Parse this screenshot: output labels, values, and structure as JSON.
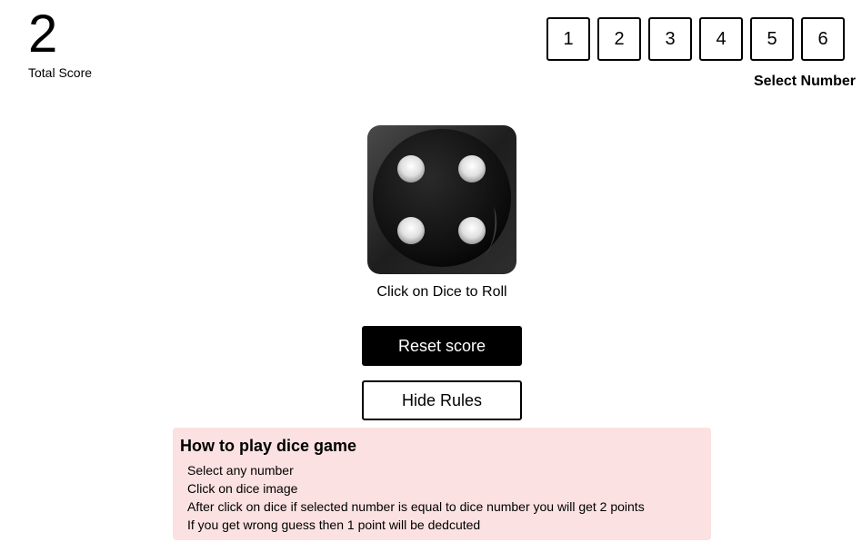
{
  "score": {
    "value": "2",
    "label": "Total Score"
  },
  "number_selector": {
    "options": [
      "1",
      "2",
      "3",
      "4",
      "5",
      "6"
    ],
    "label": "Select Number"
  },
  "dice": {
    "face_value": 4,
    "caption": "Click on Dice to Roll",
    "icon": "dice-four-icon",
    "color": "#1a1a1a"
  },
  "buttons": {
    "reset_label": "Reset score",
    "rules_label": "Hide Rules"
  },
  "rules": {
    "title": "How to play dice game",
    "items": [
      "Select any number",
      "Click on dice image",
      "After click on dice if selected number is equal to dice number you will get 2 points",
      "If you get wrong guess then 1 point will be dedcuted"
    ],
    "background": "#fbe1e1"
  }
}
